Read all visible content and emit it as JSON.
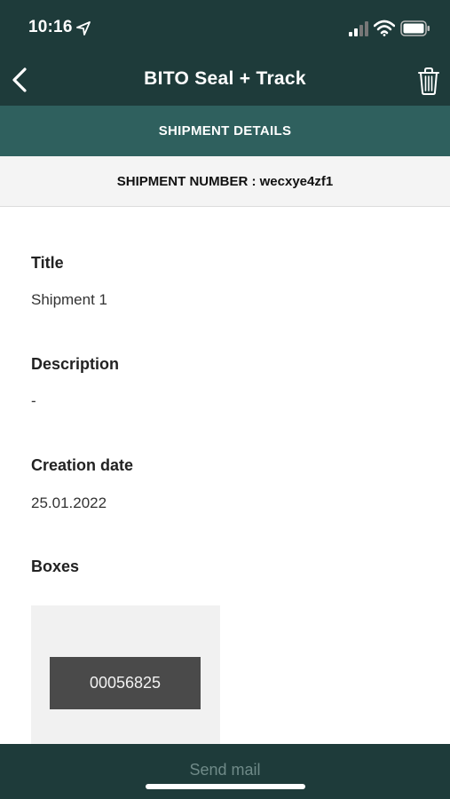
{
  "status_bar": {
    "time": "10:16"
  },
  "nav": {
    "title": "BITO Seal + Track"
  },
  "section": {
    "title": "SHIPMENT DETAILS"
  },
  "shipment": {
    "number_line": "SHIPMENT NUMBER : wecxye4zf1"
  },
  "fields": [
    {
      "label": "Title",
      "value": "Shipment 1"
    },
    {
      "label": "Description",
      "value": "-"
    },
    {
      "label": "Creation date",
      "value": "25.01.2022"
    }
  ],
  "boxes": {
    "label": "Boxes",
    "items": [
      "00056825"
    ]
  },
  "footer": {
    "send_mail_label": "Send mail"
  },
  "icons": {
    "status": [
      "location-arrow-icon",
      "signal-icon",
      "wifi-icon",
      "battery-icon"
    ],
    "nav": [
      "back-chevron-icon",
      "trash-icon"
    ]
  },
  "colors": {
    "header_bg": "#1e3b3a",
    "section_bg": "#2f605e",
    "chip_bg": "#4a4a4a",
    "disabled_text": "#6f8a88"
  }
}
